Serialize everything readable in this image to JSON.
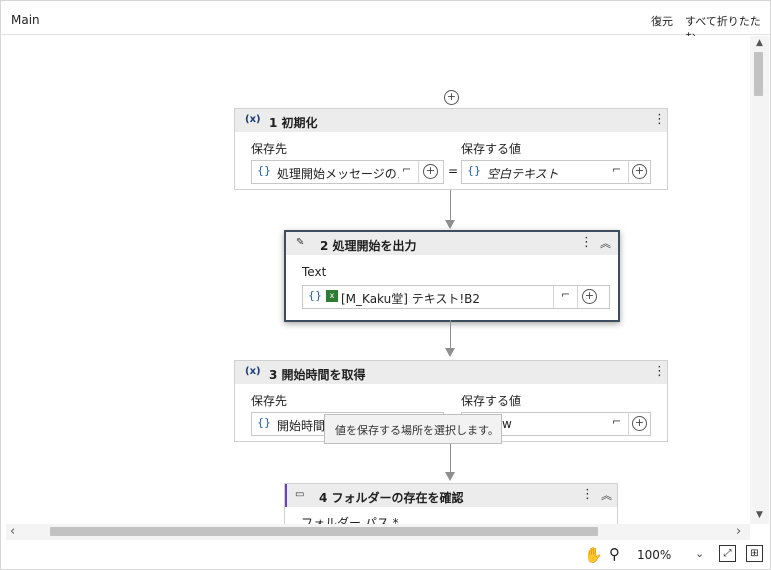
{
  "header": {
    "title": "Main",
    "restore": "復元",
    "collapse_all": "すべて折りたたむ"
  },
  "activities": [
    {
      "number_title": "1 初期化",
      "icon": "(x)",
      "left_label": "保存先",
      "right_label": "保存する値",
      "left_value": "処理開始メッセージのメ",
      "right_value": "空白テキスト"
    },
    {
      "number_title": "2 処理開始を出力",
      "icon": "pencil-icon",
      "field_label": "Text",
      "field_value": "[M_Kaku堂] テキスト!B2"
    },
    {
      "number_title": "3 開始時間を取得",
      "icon": "(x)",
      "left_label": "保存先",
      "right_label": "保存する値",
      "left_value": "開始時間",
      "right_value": "w"
    },
    {
      "number_title": "4 フォルダーの存在を確認",
      "icon": "folder-icon",
      "field_label": "フォルダー パス *"
    }
  ],
  "tooltip": "値を保存する場所を選択します。",
  "status": {
    "zoom": "100%"
  },
  "icons": {
    "brace": "{}",
    "equals": "="
  }
}
